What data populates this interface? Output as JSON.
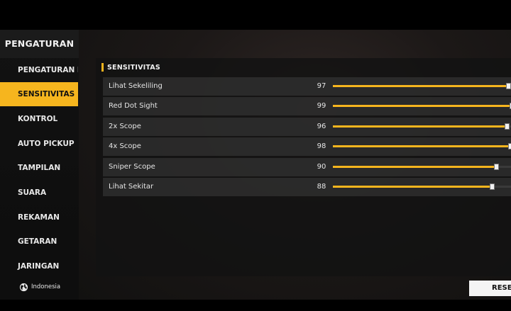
{
  "sidebar": {
    "title": "PENGATURAN",
    "items": [
      {
        "label": "PENGATURAN DA",
        "active": false
      },
      {
        "label": "SENSITIVITAS",
        "active": true
      },
      {
        "label": "KONTROL",
        "active": false
      },
      {
        "label": "AUTO PICKUP",
        "active": false
      },
      {
        "label": "TAMPILAN",
        "active": false
      },
      {
        "label": "SUARA",
        "active": false
      },
      {
        "label": "REKAMAN",
        "active": false
      },
      {
        "label": "GETARAN",
        "active": false
      },
      {
        "label": "JARINGAN",
        "active": false
      }
    ],
    "language": "Indonesia"
  },
  "section": {
    "title": "SENSITIVITAS"
  },
  "sensitivity_rows": [
    {
      "label": "Lihat Sekeliling",
      "value": "97",
      "level": 97
    },
    {
      "label": "Red Dot Sight",
      "value": "99",
      "level": 99
    },
    {
      "label": "2x Scope",
      "value": "96",
      "level": 96
    },
    {
      "label": "4x Scope",
      "value": "98",
      "level": 98
    },
    {
      "label": "Sniper Scope",
      "value": "90",
      "level": 90
    },
    {
      "label": "Lihat Sekitar",
      "value": "88",
      "level": 88
    }
  ],
  "reset_label": "RESET",
  "colors": {
    "accent": "#f6b51e",
    "background": "#000000",
    "text": "#e6e6e6"
  }
}
